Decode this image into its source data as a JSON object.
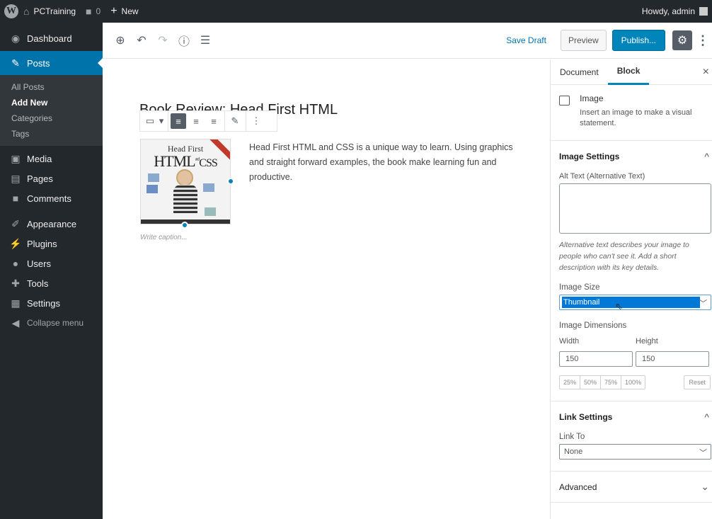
{
  "adminbar": {
    "site_name": "PCTraining",
    "comments_count": "0",
    "new_label": "New",
    "howdy": "Howdy, admin"
  },
  "sidebar": {
    "dashboard": "Dashboard",
    "posts": "Posts",
    "posts_sub": [
      "All Posts",
      "Add New",
      "Categories",
      "Tags"
    ],
    "media": "Media",
    "pages": "Pages",
    "comments": "Comments",
    "appearance": "Appearance",
    "plugins": "Plugins",
    "users": "Users",
    "tools": "Tools",
    "settings": "Settings",
    "collapse": "Collapse menu"
  },
  "header": {
    "save_draft": "Save Draft",
    "preview": "Preview",
    "publish": "Publish..."
  },
  "content": {
    "post_title": "Book Review: Head First HTML",
    "cover_title_1": "Head First",
    "cover_title_2": "HTML",
    "cover_title_3": "CSS",
    "cover_title_and": "and",
    "caption_placeholder": "Write caption...",
    "paragraph": "Head First HTML and CSS is a unique way to learn. Using graphics and straight forward examples, the book make learning fun and productive."
  },
  "settings_panel": {
    "tab_document": "Document",
    "tab_block": "Block",
    "block_name": "Image",
    "block_desc": "Insert an image to make a visual statement.",
    "image_settings": {
      "title": "Image Settings",
      "alt_label": "Alt Text (Alternative Text)",
      "alt_value": "",
      "alt_help": "Alternative text describes your image to people who can't see it. Add a short description with its key details.",
      "size_label": "Image Size",
      "size_value": "Thumbnail",
      "dims_label": "Image Dimensions",
      "width_label": "Width",
      "height_label": "Height",
      "width_value": "150",
      "height_value": "150",
      "pct_buttons": [
        "25%",
        "50%",
        "75%",
        "100%"
      ],
      "reset": "Reset"
    },
    "link_settings": {
      "title": "Link Settings",
      "link_to_label": "Link To",
      "link_to_value": "None"
    },
    "advanced": {
      "title": "Advanced"
    }
  }
}
